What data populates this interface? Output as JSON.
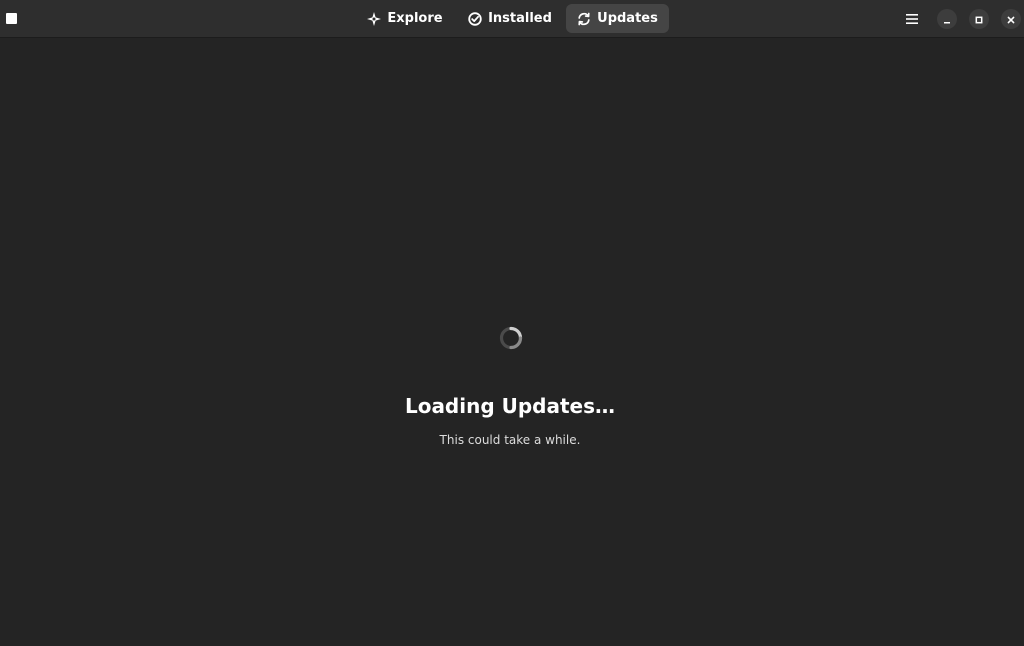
{
  "header": {
    "tabs": [
      {
        "label": "Explore",
        "icon": "explore-icon",
        "active": false
      },
      {
        "label": "Installed",
        "icon": "installed-check-icon",
        "active": false
      },
      {
        "label": "Updates",
        "icon": "updates-refresh-icon",
        "active": true
      }
    ],
    "menu_icon": "hamburger-menu-icon",
    "window_controls": [
      "minimize-icon",
      "maximize-icon",
      "close-icon"
    ]
  },
  "main": {
    "status_icon": "loading-spinner-icon",
    "title": "Loading Updates…",
    "subtitle": "This could take a while."
  },
  "colors": {
    "background": "#242424",
    "headerbar": "#2e2e2e",
    "active_tab": "#454545",
    "window_button": "#3d3d3d",
    "text": "#ffffff"
  }
}
